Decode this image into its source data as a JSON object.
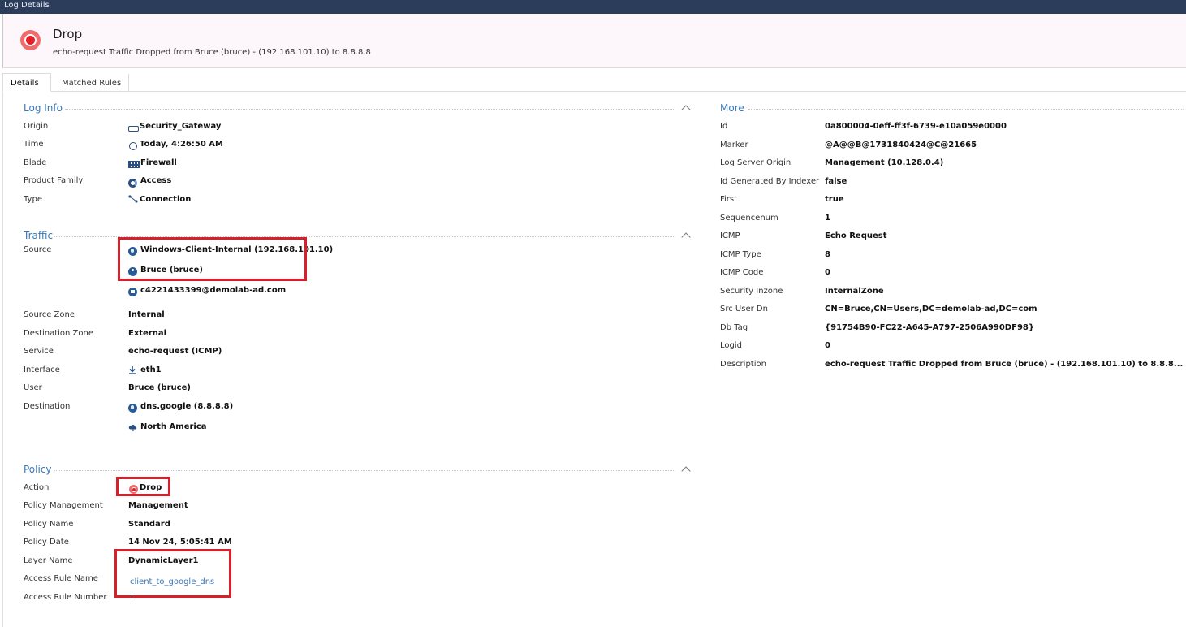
{
  "window": {
    "title": "Log Details"
  },
  "header": {
    "title": "Drop",
    "subtitle": "echo-request Traffic Dropped from Bruce (bruce) - (192.168.101.10) to 8.8.8.8"
  },
  "tabs": [
    {
      "label": "Details",
      "active": true
    },
    {
      "label": "Matched Rules",
      "active": false
    }
  ],
  "log_info": {
    "title": "Log Info",
    "rows": [
      {
        "label": "Origin",
        "value": "Security_Gateway",
        "icon": "gateway-icon"
      },
      {
        "label": "Time",
        "value": "Today, 4:26:50 AM",
        "icon": "clock-icon"
      },
      {
        "label": "Blade",
        "value": "Firewall",
        "icon": "firewall-icon"
      },
      {
        "label": "Product Family",
        "value": "Access",
        "icon": "access-icon"
      },
      {
        "label": "Type",
        "value": "Connection",
        "icon": "connection-icon"
      }
    ]
  },
  "traffic": {
    "title": "Traffic",
    "source_label": "Source",
    "source_values": [
      {
        "value": "Windows-Client-Internal (192.168.101.10)",
        "icon": "globe-icon"
      },
      {
        "value": "Bruce (bruce)",
        "icon": "user-icon"
      },
      {
        "value": "c4221433399@demolab-ad.com",
        "icon": "computer-icon"
      }
    ],
    "rows": [
      {
        "label": "Source Zone",
        "value": "Internal"
      },
      {
        "label": "Destination Zone",
        "value": "External"
      },
      {
        "label": "Service",
        "value": "echo-request (ICMP)"
      },
      {
        "label": "Interface",
        "value": "eth1",
        "icon": "download-arrow-icon"
      },
      {
        "label": "User",
        "value": "Bruce (bruce)"
      }
    ],
    "destination_label": "Destination",
    "destination_values": [
      {
        "value": "dns.google (8.8.8.8)",
        "icon": "globe-icon"
      },
      {
        "value": "North America",
        "icon": "cloud-icon"
      }
    ]
  },
  "policy": {
    "title": "Policy",
    "rows": [
      {
        "label": "Action",
        "value": "Drop",
        "icon": "drop-icon"
      },
      {
        "label": "Policy Management",
        "value": "Management"
      },
      {
        "label": "Policy Name",
        "value": "Standard"
      },
      {
        "label": "Policy Date",
        "value": "14 Nov 24, 5:05:41 AM"
      },
      {
        "label": "Layer Name",
        "value": "DynamicLayer1"
      },
      {
        "label": "Access Rule Name",
        "value": "client_to_google_dns"
      },
      {
        "label": "Access Rule Number",
        "value": ""
      }
    ]
  },
  "more": {
    "title": "More",
    "rows": [
      {
        "label": "Id",
        "value": "0a800004-0eff-ff3f-6739-e10a059e0000"
      },
      {
        "label": "Marker",
        "value": "@A@@B@1731840424@C@21665"
      },
      {
        "label": "Log Server Origin",
        "value": "Management (10.128.0.4)"
      },
      {
        "label": "Id Generated By Indexer",
        "value": "false"
      },
      {
        "label": "First",
        "value": "true"
      },
      {
        "label": "Sequencenum",
        "value": "1"
      },
      {
        "label": "ICMP",
        "value": "Echo Request"
      },
      {
        "label": "ICMP Type",
        "value": "8"
      },
      {
        "label": "ICMP Code",
        "value": "0"
      },
      {
        "label": "Security Inzone",
        "value": "InternalZone"
      },
      {
        "label": "Src User Dn",
        "value": "CN=Bruce,CN=Users,DC=demolab-ad,DC=com"
      },
      {
        "label": "Db Tag",
        "value": "{91754B90-FC22-A645-A797-2506A990DF98}"
      },
      {
        "label": "Logid",
        "value": "0"
      },
      {
        "label": "Description",
        "value": "echo-request Traffic Dropped from Bruce (bruce) - (192.168.101.10) to 8.8.8..."
      }
    ]
  },
  "colors": {
    "accent": "#3a78b8",
    "titlebar": "#2b3d5b",
    "highlight": "#d9202a",
    "drop": "#e31e26"
  }
}
